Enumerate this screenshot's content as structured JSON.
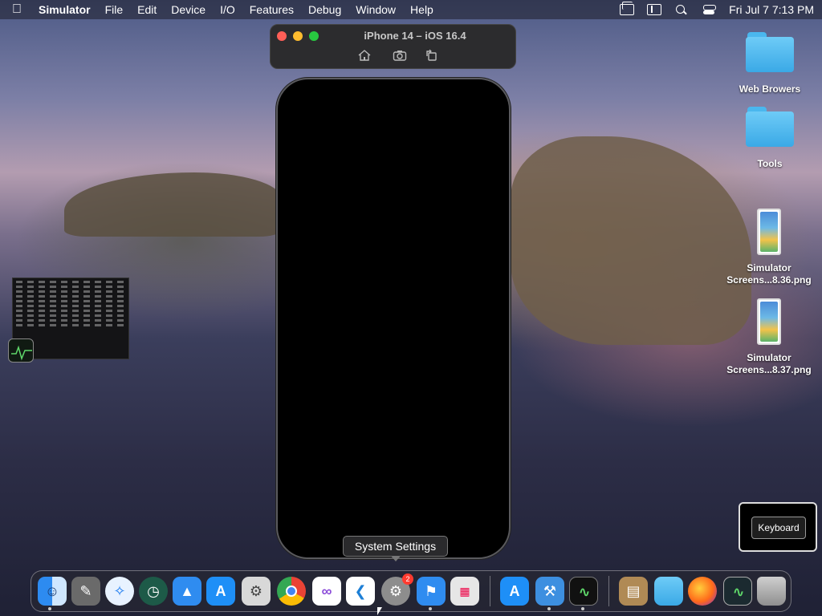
{
  "menubar": {
    "app_name": "Simulator",
    "items": [
      "File",
      "Edit",
      "Device",
      "I/O",
      "Features",
      "Debug",
      "Window",
      "Help"
    ],
    "clock": "Fri Jul 7  7:13 PM"
  },
  "simulator": {
    "title": "iPhone 14 – iOS 16.4"
  },
  "tooltip": "System Settings",
  "desktop": {
    "items": [
      {
        "label": "Web Browers",
        "type": "folder"
      },
      {
        "label": "Tools",
        "type": "folder"
      },
      {
        "label_lines": [
          "Simulator",
          "Screens...8.36.png"
        ],
        "type": "png"
      },
      {
        "label_lines": [
          "Simulator",
          "Screens...8.37.png"
        ],
        "type": "png"
      }
    ]
  },
  "keyboard": {
    "label": "Keyboard"
  },
  "dock": {
    "badge_count": "2",
    "apps": [
      "finder-icon",
      "script-editor-icon",
      "safari-icon",
      "time-machine-icon",
      "instruments-icon",
      "app-store-icon",
      "automator-icon",
      "chrome-icon",
      "visual-studio-icon",
      "vscode-icon",
      "system-settings-icon",
      "xcode-app-icon",
      "launchpad-icon",
      "app-store-2-icon",
      "xcode-icon",
      "activity-monitor-icon",
      "archive-icon",
      "folder-icon",
      "firefox-icon",
      "activity-monitor-2-icon",
      "trash-icon"
    ]
  },
  "colors": {
    "accent_red": "#ff5f57",
    "accent_yellow": "#febc2e",
    "accent_green": "#28c840",
    "folder_blue": "#4ab7ee",
    "badge_red": "#ff3b30"
  }
}
